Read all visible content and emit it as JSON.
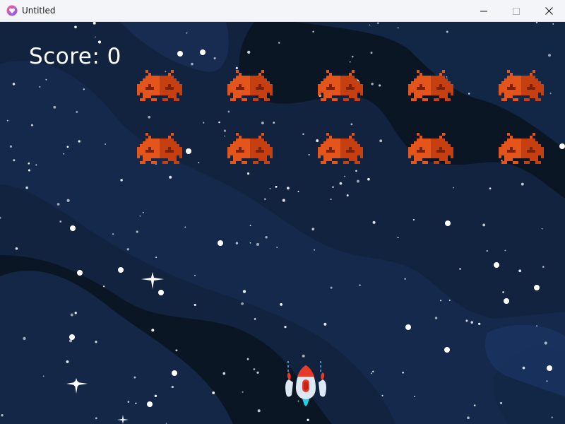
{
  "window": {
    "title": "Untitled"
  },
  "hud": {
    "score_label": "Score:",
    "score_value": 0
  },
  "colors": {
    "alien": "#e4551b",
    "alien_dark": "#c43d0f",
    "space": "#0b1624",
    "nebula": "#152848",
    "ship_body": "#dce9f5",
    "ship_red": "#e83a2a",
    "ship_flame": "#19d3e3"
  },
  "icons": [
    "app-heart-icon",
    "minimize-icon",
    "maximize-icon",
    "close-icon"
  ]
}
